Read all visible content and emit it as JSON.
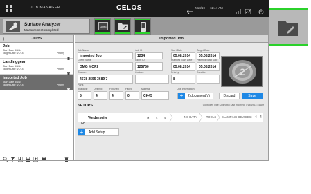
{
  "topbar": {
    "app_name": "JOB MANAGER",
    "logo": "CELOS",
    "datetime": "7/18/19 — 11:44 AM",
    "icons": [
      "menu-icon",
      "back-icon",
      "signal-icon",
      "chart-icon",
      "help-icon",
      "power-icon"
    ]
  },
  "header": {
    "app_title": "Surface Analyzer",
    "app_subtitle": "Measurement completed",
    "buttons": [
      "dmg-app-button",
      "job-folder-button",
      "device-button"
    ],
    "dmg_label": "DMG"
  },
  "jobs_panel": {
    "title": "JOBS",
    "add_label": "+",
    "jobs": [
      {
        "name": "Job",
        "start": "Start Date  5/1/14",
        "target": "Target Date  5/1/14",
        "priority": "Priority"
      },
      {
        "name": "Landinggear",
        "start": "Start Date  5/1/14",
        "target": "Target Date  5/1/14",
        "priority": "Priority"
      },
      {
        "name": "Imported Job",
        "start": "Start Date  5/1/14",
        "target": "Target Date  5/1/14",
        "priority": "Priority"
      }
    ],
    "selected_index": 2
  },
  "detail": {
    "title": "Imported Job",
    "fields": {
      "job_name": {
        "label": "Job Name",
        "value": "Imported Job"
      },
      "job_id": {
        "label": "Job ID",
        "value": "1234"
      },
      "start_date": {
        "label": "Start Date",
        "value": "05.08.2014"
      },
      "target_date": {
        "label": "Target Date",
        "value": "05.08.2014"
      },
      "client_name": {
        "label": "Client Name",
        "value": "DMG MORI"
      },
      "client_id": {
        "label": "Client ID",
        "value": "125750"
      },
      "planned_start": {
        "label": "Planned Start Date",
        "value": "05.08.2014"
      },
      "planned_target": {
        "label": "Planned Start Date",
        "value": "05.08.2014"
      },
      "custom1": {
        "label": "Custom",
        "value": "4578 2555 3689 7"
      },
      "custom2": {
        "label": "Custom",
        "value": ""
      },
      "priority": {
        "label": "Priority",
        "value": "8"
      },
      "duration": {
        "label": "Duration",
        "value": ""
      },
      "parts_label": "Parts",
      "available": {
        "label": "Available",
        "value": "5"
      },
      "desired": {
        "label": "Desired",
        "value": "4"
      },
      "finished": {
        "label": "Finished",
        "value": "4"
      },
      "failed": {
        "label": "Failed",
        "value": "0"
      },
      "material": {
        "label": "Material",
        "value": "CK45"
      },
      "job_information_label": "Job information"
    },
    "documents_button": "2 document(s)",
    "discard_button": "Discard",
    "save_button": "Save"
  },
  "setups": {
    "title": "SETUPS",
    "controller_type": "Controller Type: Unknown     Last modified: 7/18/19 11:44 AM",
    "row": {
      "name": "Vorderseite",
      "star": "★",
      "prev": "4",
      "count": "4",
      "steps": [
        "NC DATA",
        "TOOLS",
        "CLAMPING DEVICES"
      ],
      "page_prev": "‹",
      "page": "4",
      "page_next": "4"
    },
    "add_setup": "Add Setup"
  },
  "colors": {
    "accent": "#1e88e5",
    "active_green": "#2bd12b",
    "topbar": "#1a1a1a",
    "header": "#9a9a9a",
    "selected_row": "#6d6d6d"
  }
}
